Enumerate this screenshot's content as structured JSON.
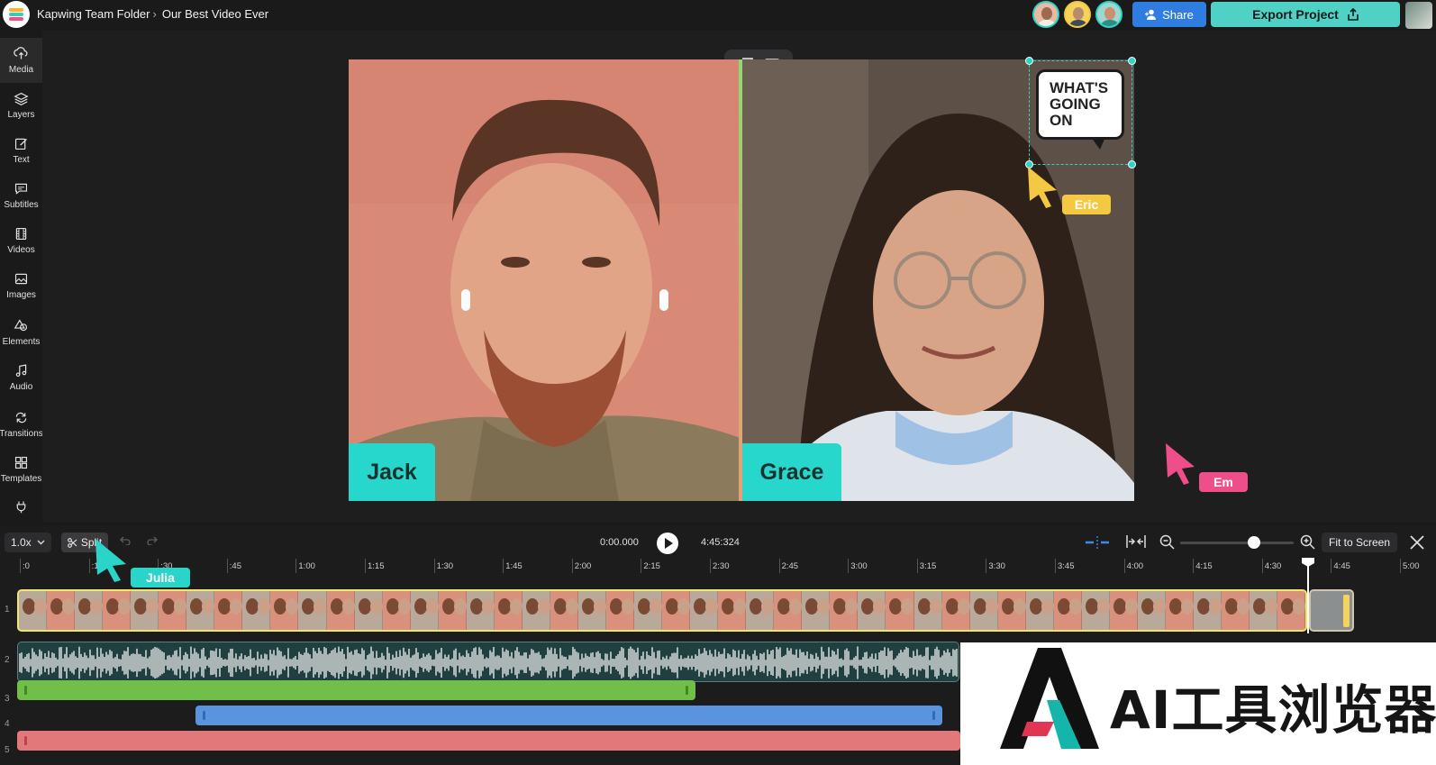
{
  "breadcrumb": {
    "folder": "Kapwing Team Folder",
    "separator": "›",
    "project": "Our Best Video Ever"
  },
  "header": {
    "share_label": "Share",
    "export_label": "Export Project"
  },
  "sidebar": {
    "items": [
      {
        "label": "Media",
        "icon": "upload-icon"
      },
      {
        "label": "Layers",
        "icon": "layers-icon"
      },
      {
        "label": "Text",
        "icon": "text-edit-icon"
      },
      {
        "label": "Subtitles",
        "icon": "subtitles-icon"
      },
      {
        "label": "Videos",
        "icon": "film-icon"
      },
      {
        "label": "Images",
        "icon": "image-icon"
      },
      {
        "label": "Elements",
        "icon": "shapes-icon"
      },
      {
        "label": "Audio",
        "icon": "music-note-icon"
      },
      {
        "label": "Transitions",
        "icon": "transition-icon"
      },
      {
        "label": "Templates",
        "icon": "grid-icon"
      }
    ]
  },
  "canvas": {
    "left_name": "Jack",
    "right_name": "Grace",
    "bubble_line1": "WHAT'S",
    "bubble_line2": "GOING",
    "bubble_line3": "ON",
    "cursors": {
      "eric": "Eric",
      "em": "Em",
      "julia": "Julia"
    }
  },
  "timeline": {
    "speed": "1.0x",
    "split_label": "Split",
    "current_time": "0:00.000",
    "total_time": "4:45:324",
    "fit_label": "Fit to Screen",
    "ruler_labels": [
      ":0",
      ":15",
      ":30",
      ":45",
      "1:00",
      "1:15",
      "1:30",
      "1:45",
      "2:00",
      "2:15",
      "2:30",
      "2:45",
      "3:00",
      "3:15",
      "3:30",
      "3:45",
      "4:00",
      "4:15",
      "4:30",
      "4:45",
      "5:00"
    ],
    "row_numbers": [
      "1",
      "2",
      "3",
      "4",
      "5"
    ]
  },
  "watermark": {
    "text": "AI工具浏览器"
  },
  "colors": {
    "accent": "#4fd1c5",
    "share": "#2f7de1",
    "nametag": "#27d7cb",
    "eric": "#f5c842",
    "em": "#ee4f8b",
    "julia": "#2bd4c8"
  }
}
